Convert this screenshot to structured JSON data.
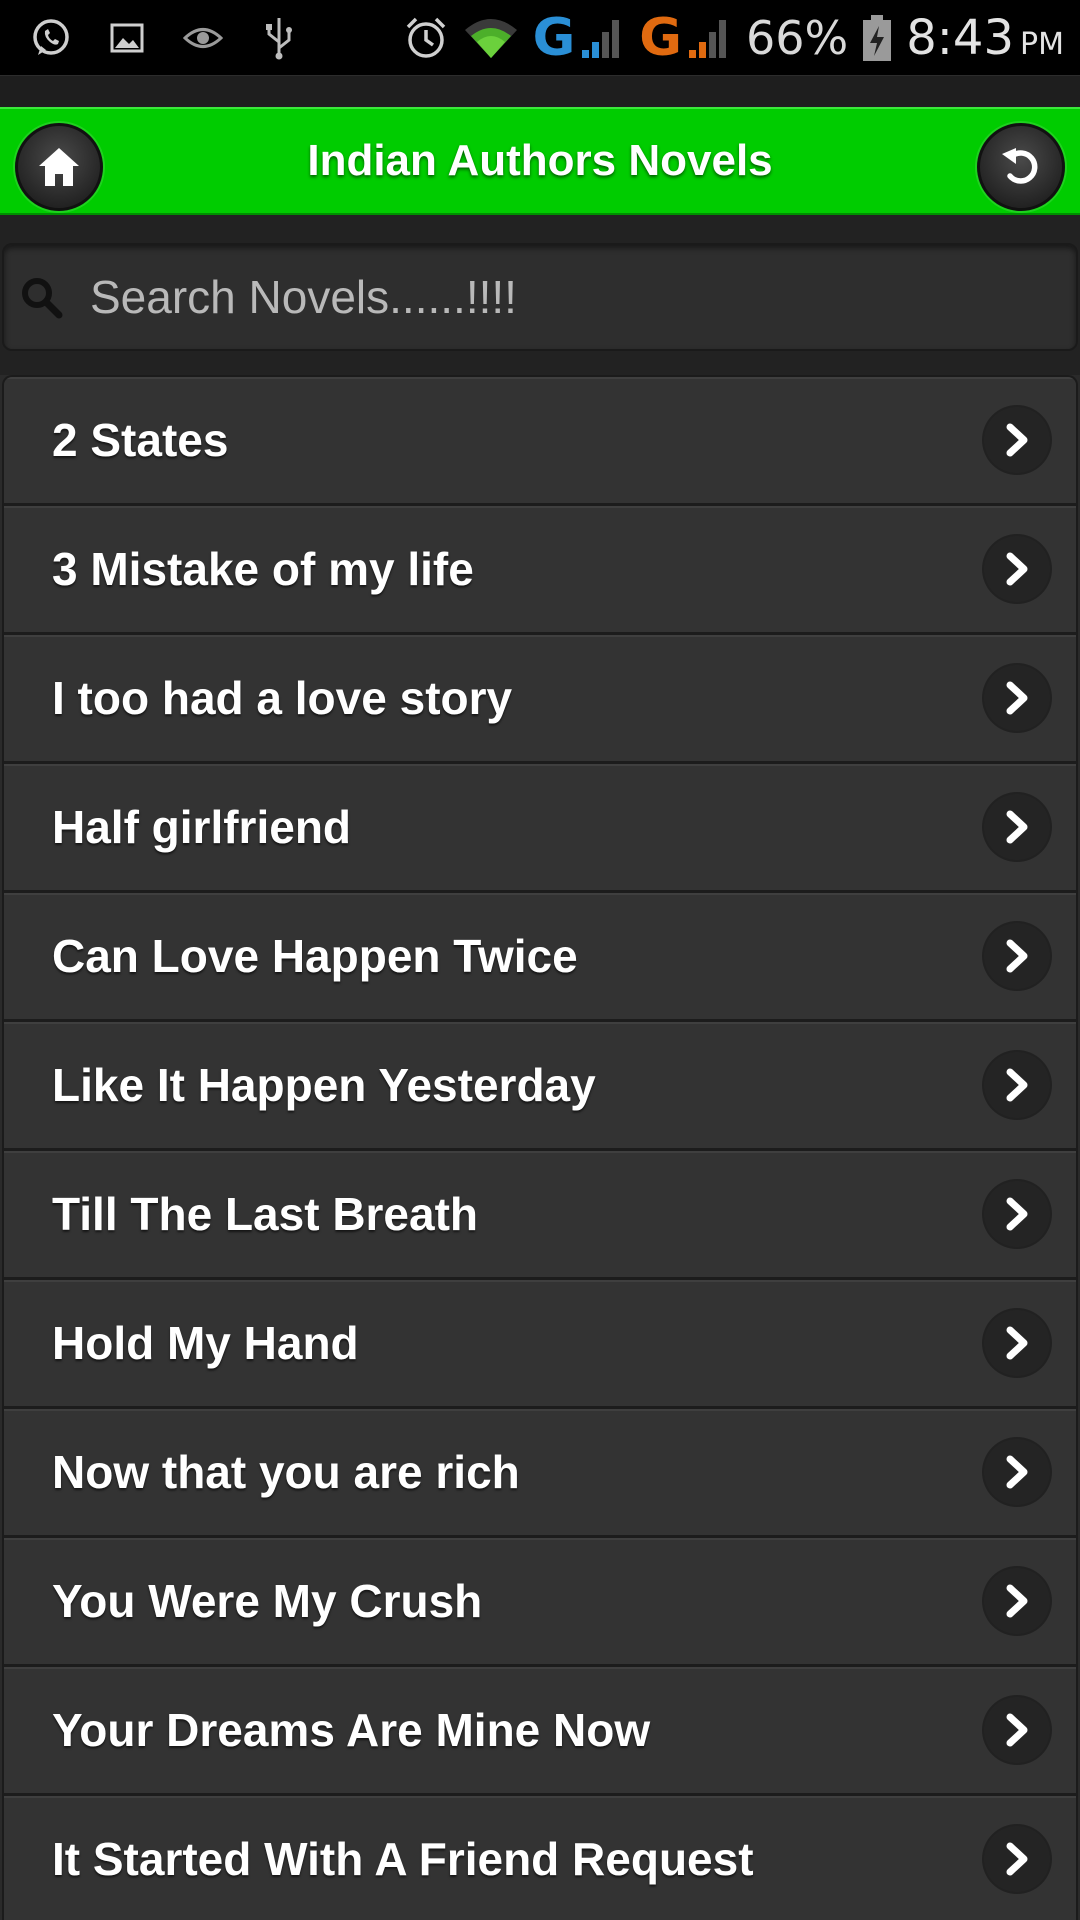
{
  "status_bar": {
    "left_icons": [
      "whatsapp-icon",
      "image-icon",
      "eye-icon",
      "usb-icon"
    ],
    "right_icons": [
      "alarm-icon",
      "wifi-icon",
      "signal-icon",
      "signal-icon",
      "battery-charging-icon"
    ],
    "network1": "G",
    "network2": "G",
    "battery": "66%",
    "time": "8:43",
    "ampm": "PM",
    "colors": {
      "wifi": "#4caf2a",
      "network1": "#2a8fd6",
      "network2": "#e06a10"
    }
  },
  "header": {
    "title": "Indian Authors Novels",
    "home_icon": "home-icon",
    "back_icon": "undo-icon",
    "accent": "#00cc00"
  },
  "search": {
    "placeholder": "Search Novels......!!!!",
    "value": "",
    "icon": "search-icon"
  },
  "novels": {
    "items": [
      {
        "label": "2 States"
      },
      {
        "label": "3 Mistake of my life"
      },
      {
        "label": "I too had a love story"
      },
      {
        "label": "Half girlfriend"
      },
      {
        "label": "Can Love Happen Twice"
      },
      {
        "label": "Like It Happen Yesterday"
      },
      {
        "label": "Till The Last Breath"
      },
      {
        "label": "Hold My Hand"
      },
      {
        "label": "Now that you are rich"
      },
      {
        "label": "You Were My Crush"
      },
      {
        "label": "Your Dreams Are Mine Now"
      },
      {
        "label": "It Started With A Friend Request"
      }
    ],
    "chevron_icon": "chevron-right-icon"
  }
}
